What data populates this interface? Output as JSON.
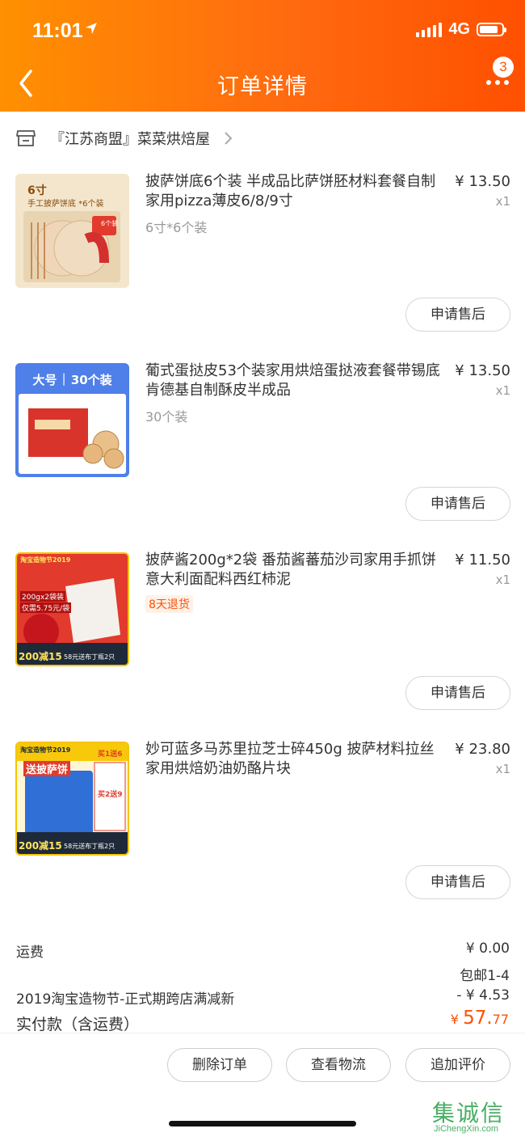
{
  "status_bar": {
    "time": "11:01",
    "network": "4G"
  },
  "header": {
    "title": "订单详情",
    "badge_count": "3"
  },
  "shop": {
    "name": "『江苏商盟』菜菜烘焙屋"
  },
  "items": [
    {
      "name": "披萨饼底6个装 半成品比萨饼胚材料套餐自制家用pizza薄皮6/8/9寸",
      "spec": "6寸*6个装",
      "tag": "",
      "price": "¥ 13.50",
      "qty": "x1",
      "after_sale": "申请售后",
      "thumb": {
        "label_top": "6寸",
        "label_sub": "手工披萨饼底 *6个装",
        "badge": "6个装"
      }
    },
    {
      "name": "葡式蛋挞皮53个装家用烘焙蛋挞液套餐带锡底肯德基自制酥皮半成品",
      "spec": "30个装",
      "tag": "",
      "price": "¥ 13.50",
      "qty": "x1",
      "after_sale": "申请售后",
      "thumb": {
        "left": "大号",
        "right": "30个装"
      }
    },
    {
      "name": "披萨酱200g*2袋 番茄酱蕃茄沙司家用手抓饼意大利面配料西红柿泥",
      "spec": "",
      "tag": "8天退货",
      "price": "¥ 11.50",
      "qty": "x1",
      "after_sale": "申请售后",
      "thumb": {
        "top": "淘宝造物节2019",
        "mid": "200gx2袋装",
        "mid2": "仅需5.75元/袋",
        "bottom": "200减15",
        "bottom2": "58元送布丁瓶2只"
      }
    },
    {
      "name": "妙可蓝多马苏里拉芝士碎450g 披萨材料拉丝家用烘焙奶油奶酪片块",
      "spec": "",
      "tag": "",
      "price": "¥ 23.80",
      "qty": "x1",
      "after_sale": "申请售后",
      "thumb": {
        "top": "淘宝造物节2019",
        "mid": "送披萨饼",
        "side1": "买1送6",
        "side2": "买2送9",
        "bottom": "200减15",
        "bottom2": "58元送布丁瓶2只"
      }
    }
  ],
  "summary": {
    "shipping_label": "运费",
    "shipping_value": "¥ 0.00",
    "shipping_note": "包邮1-4",
    "discount_label": "2019淘宝造物节-正式期跨店满减新",
    "discount_value": "- ¥ 4.53",
    "total_label": "实付款（含运费）",
    "total_symbol": "¥ ",
    "total_int": "57.",
    "total_dec": "77"
  },
  "actions": {
    "delete": "删除订单",
    "logistics": "查看物流",
    "review": "追加评价"
  },
  "watermark": {
    "cn": "集诚信",
    "en": "JiChengXin.com"
  },
  "colors": {
    "accent": "#ff5000",
    "header_start": "#ff9000"
  }
}
